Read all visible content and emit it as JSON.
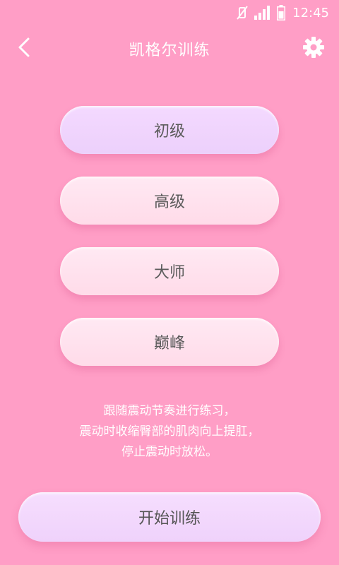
{
  "status_bar": {
    "time": "12:45",
    "icons": [
      "vibrate-off-icon",
      "signal-icon",
      "battery-icon"
    ]
  },
  "app_bar": {
    "title": "凯格尔训练",
    "back_icon": "back-arrow-icon",
    "settings_icon": "gear-icon"
  },
  "levels": [
    {
      "label": "初级",
      "selected": true
    },
    {
      "label": "高级",
      "selected": false
    },
    {
      "label": "大师",
      "selected": false
    },
    {
      "label": "巅峰",
      "selected": false
    }
  ],
  "hint": {
    "line1": "跟随震动节奏进行练习，",
    "line2": "震动时收缩臀部的肌肉向上提肛，",
    "line3": "停止震动时放松。"
  },
  "start_button": {
    "label": "开始训练"
  },
  "colors": {
    "background": "#ff9ec6",
    "button": "#ffe4ef",
    "button_selected": "#f1d6ff",
    "text_dark": "#5b5b5b",
    "text_light": "#ffffff"
  }
}
